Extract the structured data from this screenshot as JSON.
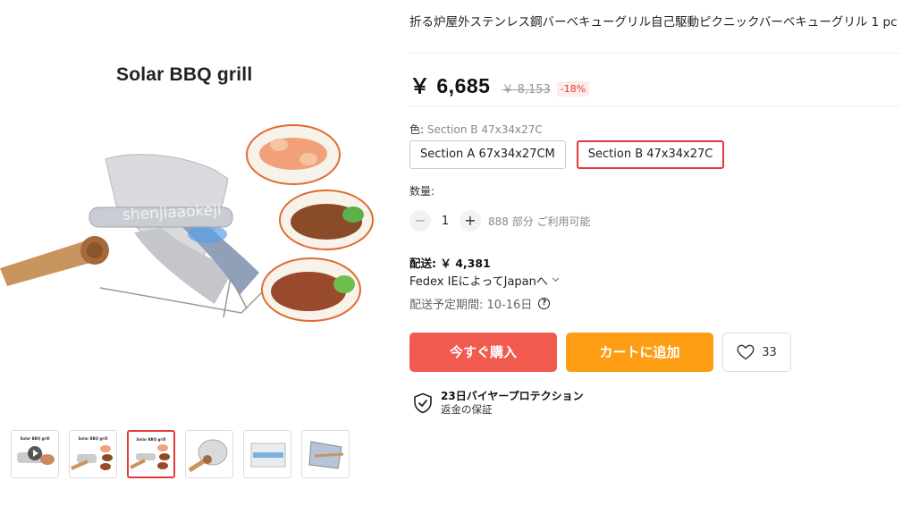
{
  "gallery": {
    "image_title": "Solar BBQ grill",
    "watermark": "shenjiaaokeji",
    "thumbnails": [
      {
        "title": "Solar BBQ grill",
        "type": "video"
      },
      {
        "title": "Solar BBQ grill",
        "type": "image"
      },
      {
        "title": "Solar BBQ grill",
        "type": "image",
        "active": true
      },
      {
        "title": "",
        "type": "image"
      },
      {
        "title": "",
        "type": "image"
      },
      {
        "title": "",
        "type": "image"
      }
    ]
  },
  "product": {
    "title": "折る炉屋外ステンレス鋼バーベキューグリル自己駆動ピクニックバーベキューグリル 1 pc",
    "price": "￥ 6,685",
    "old_price": "￥ 8,153",
    "discount": "-18%"
  },
  "variants": {
    "label": "色:",
    "selected": "Section B 47x34x27C",
    "options": [
      {
        "label": "Section A 67x34x27CM",
        "active": false
      },
      {
        "label": "Section B 47x34x27C",
        "active": true
      }
    ]
  },
  "quantity": {
    "label": "数量:",
    "minus": "−",
    "plus": "+",
    "value": "1",
    "available": "888 部分 ご利用可能"
  },
  "shipping": {
    "label": "配送: ￥ 4,381",
    "carrier": "Fedex IEによってJapanへ",
    "delivery": "配送予定期間: 10-16日",
    "help_glyph": "?"
  },
  "actions": {
    "buy_now": "今すぐ購入",
    "add_to_cart": "カートに追加",
    "wishlist_count": "33",
    "buy_color": "#f05a4f",
    "cart_color": "#fd9d14"
  },
  "protection": {
    "title": "23日バイヤープロテクション",
    "subtitle": "返金の保証"
  }
}
